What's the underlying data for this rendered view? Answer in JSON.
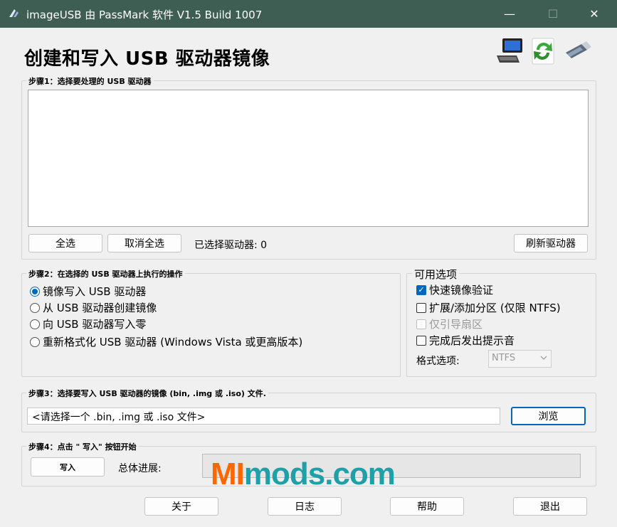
{
  "window": {
    "title": "imageUSB 由 PassMark 软件 V1.5 Build 1007",
    "minimize_glyph": "—",
    "maximize_glyph": "☐",
    "close_glyph": "✕"
  },
  "header": {
    "title": "创建和写入 USB 驱动器镜像",
    "icons": [
      "computer-icon",
      "refresh-arrows-icon",
      "usb-drive-icon"
    ]
  },
  "step1": {
    "label": "步骤1：选择要处理的 USB 驱动器",
    "drives": [],
    "select_all": "全选",
    "deselect_all": "取消全选",
    "selected_count": "已选择驱动器: 0",
    "refresh": "刷新驱动器"
  },
  "step2": {
    "label": "步骤2：在选择的 USB 驱动器上执行的操作",
    "actions": [
      {
        "label": "镜像写入 USB 驱动器",
        "selected": true
      },
      {
        "label": "从 USB 驱动器创建镜像",
        "selected": false
      },
      {
        "label": "向 USB 驱动器写入零",
        "selected": false
      },
      {
        "label": "重新格式化 USB 驱动器 (Windows Vista 或更高版本)",
        "selected": false
      }
    ]
  },
  "options": {
    "label": "可用选项",
    "items": [
      {
        "label": "快速镜像验证",
        "checked": true,
        "enabled": true
      },
      {
        "label": "扩展/添加分区 (仅限 NTFS)",
        "checked": false,
        "enabled": true
      },
      {
        "label": "仅引导扇区",
        "checked": false,
        "enabled": false
      },
      {
        "label": "完成后发出提示音",
        "checked": false,
        "enabled": true
      }
    ],
    "format_label": "格式选项:",
    "format_value": "NTFS"
  },
  "step3": {
    "label": "步骤3：选择要写入 USB 驱动器的镜像 (bin, .img 或 .iso) 文件.",
    "file_value": "<请选择一个 .bin, .img 或 .iso 文件>",
    "browse": "浏览"
  },
  "step4": {
    "label": "步骤4：点击 \" 写入\" 按钮开始",
    "write": "写入",
    "progress_label": "总体进展:",
    "progress": 0
  },
  "footer": {
    "about": "关于",
    "log": "日志",
    "help": "帮助",
    "exit": "退出"
  },
  "watermark": {
    "part1": "MI",
    "part2": "mods.com"
  },
  "colors": {
    "titlebar": "#3e5e54",
    "accent": "#0067c0",
    "watermark_orange": "#ff6600",
    "watermark_teal": "#1f9fa8"
  }
}
